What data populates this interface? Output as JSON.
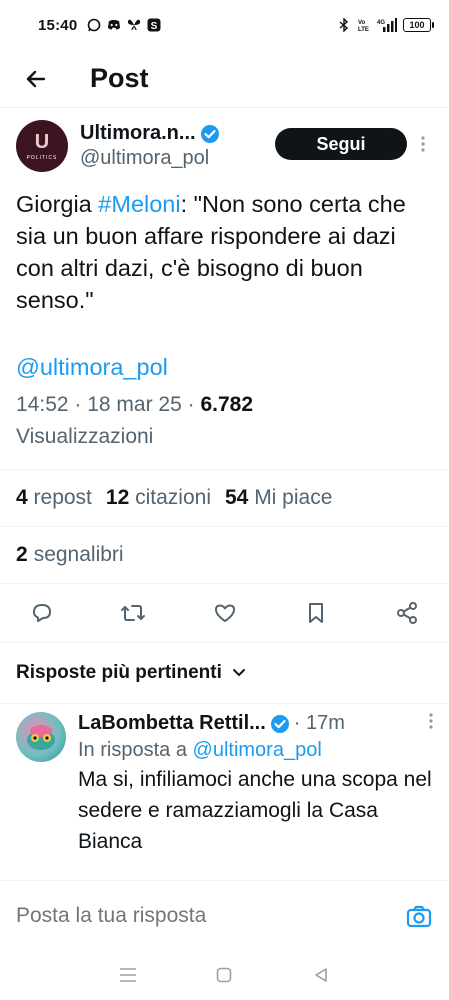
{
  "status_bar": {
    "time": "15:40",
    "icons_left": [
      "whatsapp-icon",
      "discord-icon",
      "butterfly-icon",
      "s-app-icon"
    ],
    "network": "4G",
    "battery": "100"
  },
  "header": {
    "title": "Post"
  },
  "post": {
    "author_name": "Ultimora.n...",
    "handle": "@ultimora_pol",
    "avatar_letter": "U",
    "avatar_sub": "POLITICS",
    "follow_label": "Segui",
    "text_before": "Giorgia ",
    "hashtag": "#Meloni",
    "text_after": ": \"Non sono certa che sia un buon affare rispondere ai dazi con altri dazi, c'è bisogno di buon senso.\"",
    "mention": "@ultimora_pol",
    "time": "14:52",
    "date": "18 mar 25",
    "views_count": "6.782",
    "views_label": "Visualizzazioni",
    "reposts_count": "4",
    "reposts_label": "repost",
    "quotes_count": "12",
    "quotes_label": "citazioni",
    "likes_count": "54",
    "likes_label": "Mi piace",
    "bookmarks_count": "2",
    "bookmarks_label": "segnalibri"
  },
  "replies": {
    "header": "Risposte più pertinenti",
    "items": [
      {
        "name": "LaBombetta Rettil...",
        "time": "17m",
        "reply_to_label": "In risposta a",
        "reply_to_handle": "@ultimora_pol",
        "text": "Ma si, infiliamoci anche una scopa nel sedere e ramazziamogli la Casa Bianca"
      }
    ]
  },
  "compose": {
    "placeholder": "Posta la tua risposta"
  },
  "colors": {
    "accent": "#1d9bf0",
    "text": "#0f1419",
    "muted": "#536471"
  }
}
